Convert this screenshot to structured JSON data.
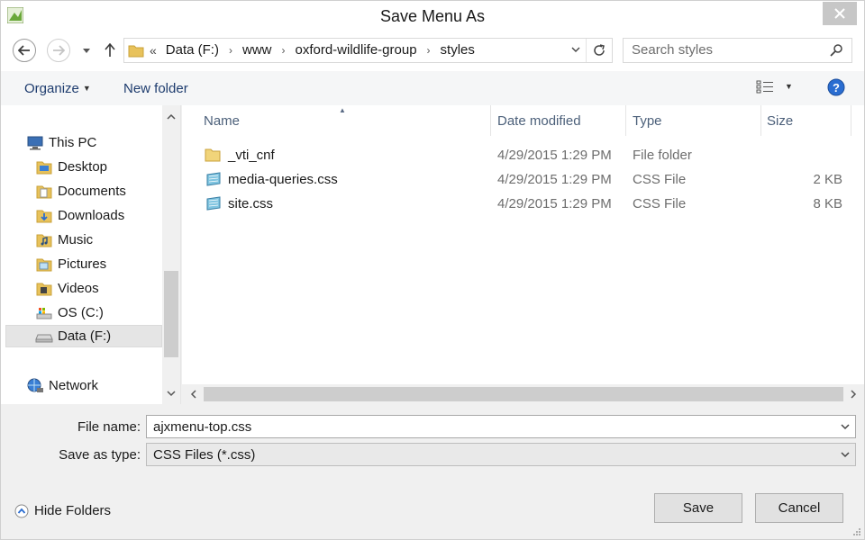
{
  "window": {
    "title": "Save Menu As"
  },
  "address": {
    "lead": "«",
    "crumbs": [
      "Data (F:)",
      "www",
      "oxford-wildlife-group",
      "styles"
    ]
  },
  "search": {
    "placeholder": "Search styles"
  },
  "toolbar": {
    "organize_label": "Organize",
    "new_folder_label": "New folder"
  },
  "nav": {
    "items": [
      {
        "label": "This PC",
        "icon": "computer-icon"
      },
      {
        "label": "Desktop",
        "icon": "desktop-folder-icon"
      },
      {
        "label": "Documents",
        "icon": "documents-folder-icon"
      },
      {
        "label": "Downloads",
        "icon": "downloads-folder-icon"
      },
      {
        "label": "Music",
        "icon": "music-folder-icon"
      },
      {
        "label": "Pictures",
        "icon": "pictures-folder-icon"
      },
      {
        "label": "Videos",
        "icon": "videos-folder-icon"
      },
      {
        "label": "OS (C:)",
        "icon": "system-drive-icon"
      },
      {
        "label": "Data (F:)",
        "icon": "drive-icon",
        "selected": true
      },
      {
        "label": "Network",
        "icon": "network-icon"
      }
    ]
  },
  "columns": {
    "name": "Name",
    "date": "Date modified",
    "type": "Type",
    "size": "Size"
  },
  "files": [
    {
      "name": "_vti_cnf",
      "date": "4/29/2015 1:29 PM",
      "type": "File folder",
      "size": ""
    },
    {
      "name": "media-queries.css",
      "date": "4/29/2015 1:29 PM",
      "type": "CSS File",
      "size": "2 KB"
    },
    {
      "name": "site.css",
      "date": "4/29/2015 1:29 PM",
      "type": "CSS File",
      "size": "8 KB"
    }
  ],
  "form": {
    "file_name_label": "File name:",
    "file_name_value": "ajxmenu-top.css",
    "save_type_label": "Save as type:",
    "save_type_value": "CSS Files (*.css)"
  },
  "footer": {
    "hide_folders_label": "Hide Folders",
    "save_label": "Save",
    "cancel_label": "Cancel"
  },
  "colors": {
    "accent": "#1e3c6e",
    "folder": "#e8c25b",
    "help": "#2a6dd1"
  }
}
